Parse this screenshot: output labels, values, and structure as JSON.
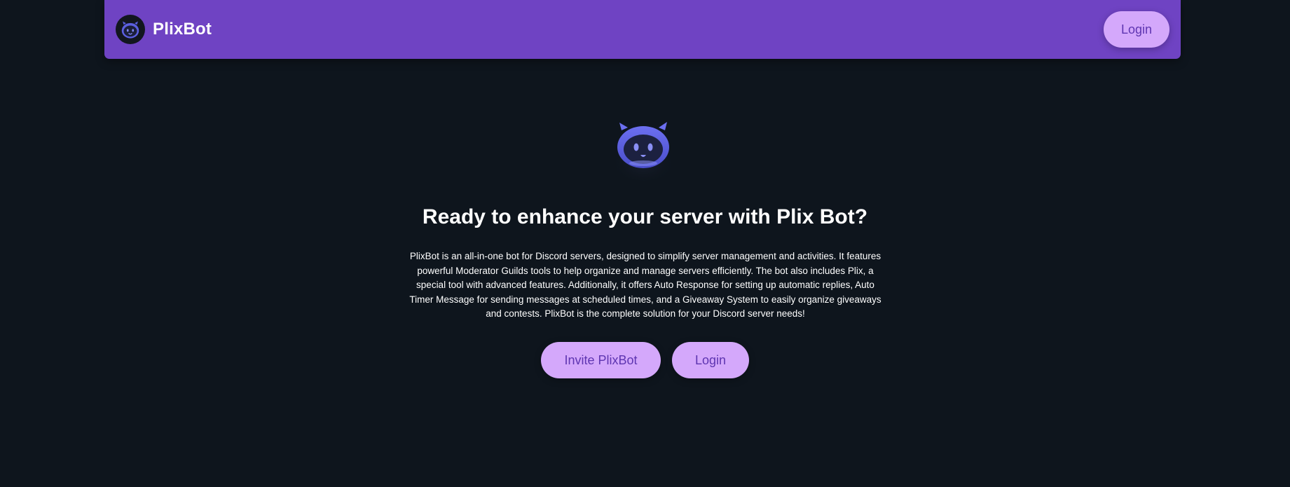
{
  "navbar": {
    "brand_name": "PlixBot",
    "login_label": "Login",
    "color": "#6f43c3"
  },
  "hero": {
    "title": "Ready to enhance your server with Plix Bot?",
    "description": "PlixBot is an all-in-one bot for Discord servers, designed to simplify server management and activities. It features powerful Moderator Guilds tools to help organize and manage servers efficiently. The bot also includes Plix, a special tool with advanced features. Additionally, it offers Auto Response for setting up automatic replies, Auto Timer Message for sending messages at scheduled times, and a Giveaway System to easily organize giveaways and contests. PlixBot is the complete solution for your Discord server needs!",
    "invite_label": "Invite PlixBot",
    "login_label": "Login"
  },
  "colors": {
    "background": "#0e151d",
    "button_bg": "#d4a8fb",
    "button_text": "#5e35b1",
    "mascot": "#5b5fe0"
  },
  "icons": {
    "brand_logo": "plixbot-mascot-icon",
    "hero_logo": "plixbot-mascot-icon"
  }
}
